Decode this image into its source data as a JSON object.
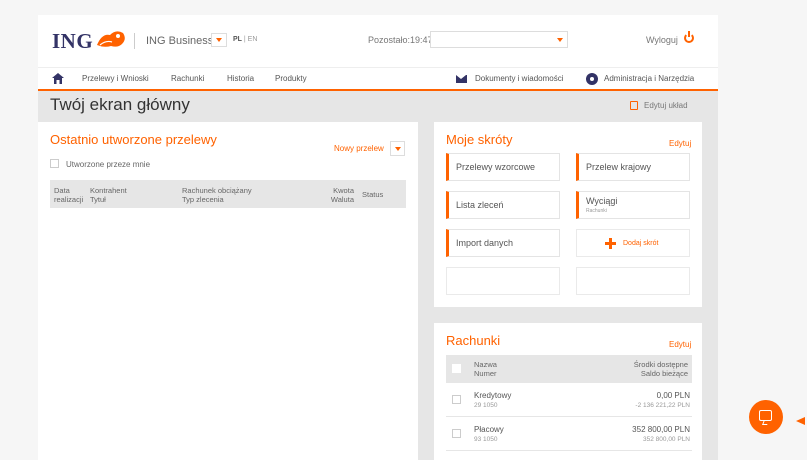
{
  "header": {
    "logo_text": "ING",
    "product": "ING Business",
    "lang_active": "PL",
    "lang_sep": " | ",
    "lang_other": "EN",
    "session_remaining": "Pozostało:19:47",
    "session_value": "",
    "logout": "Wyloguj"
  },
  "nav": {
    "items": [
      "Przelewy i Wnioski",
      "Rachunki",
      "Historia",
      "Produkty"
    ],
    "documents": "Dokumenty i wiadomości",
    "admin": "Administracja i Narzędzia"
  },
  "page": {
    "title": "Twój ekran główny",
    "edit_layout": "Edytuj układ"
  },
  "recent_transfers": {
    "title": "Ostatnio utworzone przelewy",
    "new_transfer": "Nowy przelew",
    "created_by_me": "Utworzone przeze mnie",
    "columns": {
      "date_1": "Data",
      "date_2": "realizacji",
      "counterparty": "Kontrahent",
      "title": "Tytuł",
      "debit_account": "Rachunek obciążany",
      "order_type": "Typ zlecenia",
      "amount": "Kwota",
      "currency": "Waluta",
      "status": "Status"
    }
  },
  "shortcuts": {
    "title": "Moje skróty",
    "edit": "Edytuj",
    "tiles": {
      "templates": "Przelewy wzorcowe",
      "domestic": "Przelew krajowy",
      "orders": "Lista zleceń",
      "statements": "Wyciągi",
      "statements_sub": "Rachunki",
      "import": "Import danych"
    },
    "add": "Dodaj skrót"
  },
  "accounts": {
    "title": "Rachunki",
    "edit": "Edytuj",
    "columns": {
      "name": "Nazwa",
      "number": "Numer",
      "available": "Środki dostępne",
      "balance": "Saldo bieżące"
    },
    "rows": [
      {
        "name": "Kredytowy",
        "number": "29 1050",
        "available": "0,00 PLN",
        "balance": "-2 136 221,22 PLN"
      },
      {
        "name": "Płacowy",
        "number": "93 1050",
        "available": "352 800,00 PLN",
        "balance": "352 800,00 PLN"
      }
    ]
  },
  "colors": {
    "accent": "#ff6200",
    "brand_navy": "#333366",
    "panel_bg": "#ffffff",
    "page_bg": "#e6e6e6"
  }
}
